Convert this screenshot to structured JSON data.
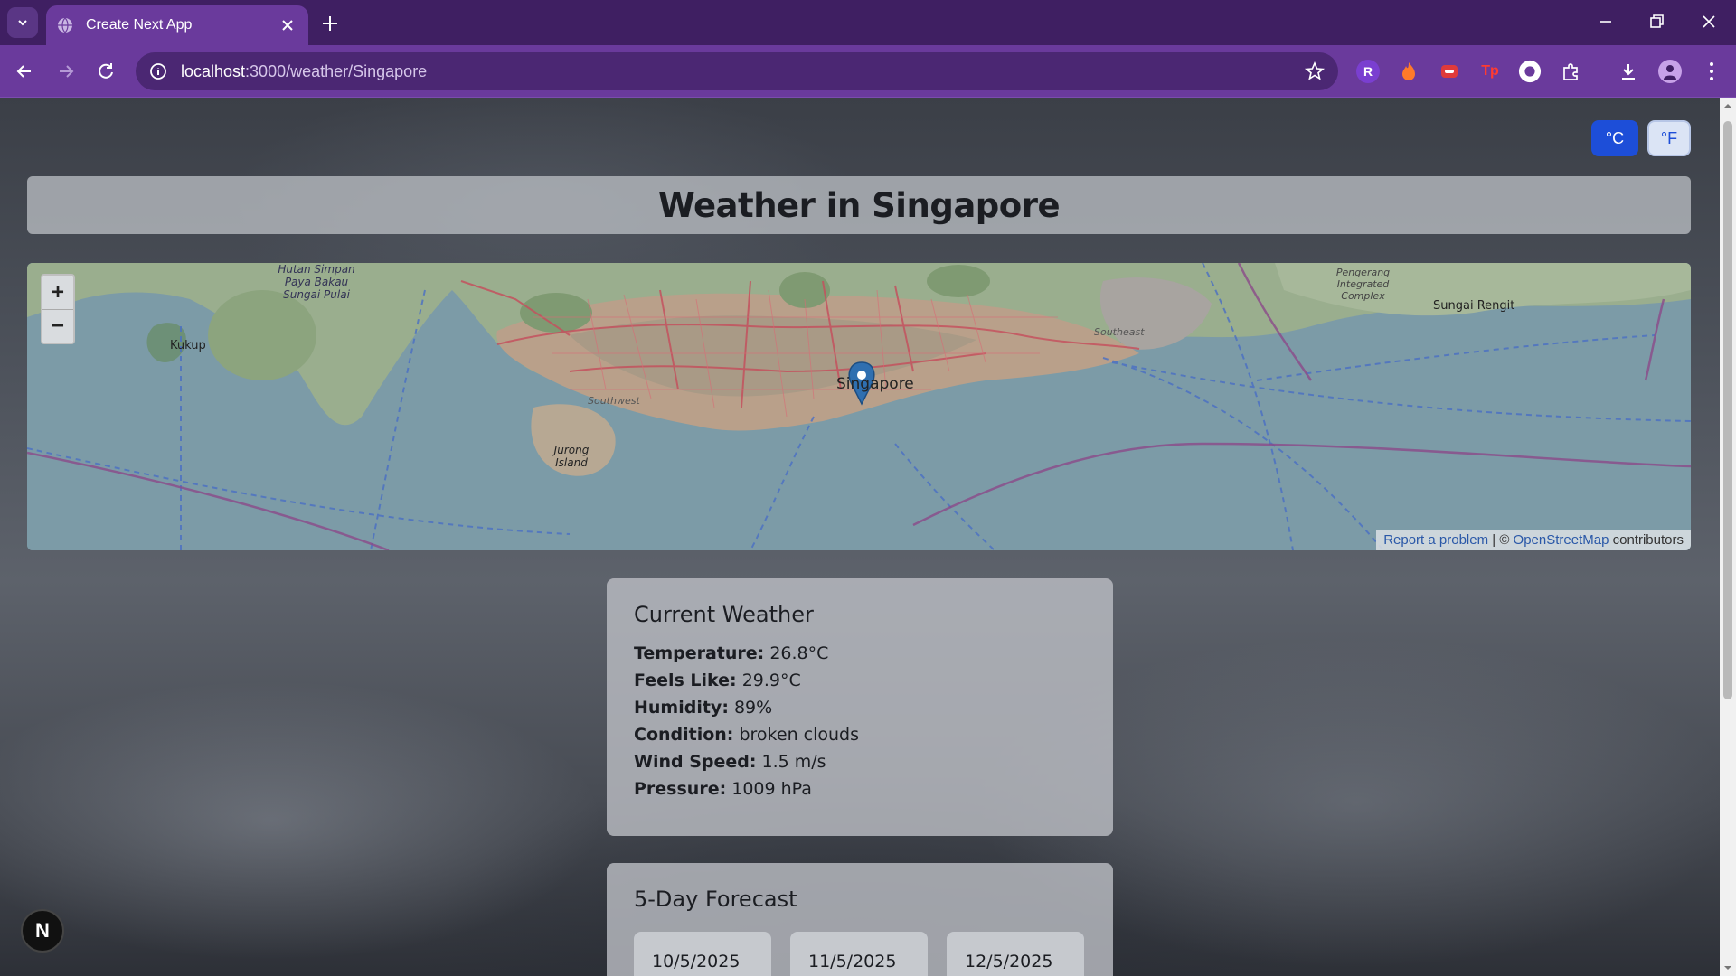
{
  "browser": {
    "tab_title": "Create Next App",
    "url_host": "localhost",
    "url_path": ":3000/weather/Singapore"
  },
  "units": {
    "celsius_label": "°C",
    "fahrenheit_label": "°F",
    "selected": "celsius"
  },
  "page_title": "Weather in Singapore",
  "map": {
    "zoom_in": "+",
    "zoom_out": "−",
    "attribution_report": "Report a problem",
    "attribution_sep": " | © ",
    "attribution_osm": "OpenStreetMap",
    "attribution_suffix": " contributors",
    "labels": {
      "kukup": "Kukup",
      "jurong": "Jurong Island",
      "singapore": "Singapore",
      "southwest": "Southwest",
      "southeast": "Southeast",
      "sungai_rengit": "Sungai Rengit",
      "pengerang": "Pengerang Integrated Complex",
      "hutan": "Hutan Simpan Paya Bakau Sungai Pulai"
    }
  },
  "current": {
    "heading": "Current Weather",
    "rows": [
      {
        "label": "Temperature:",
        "value": "26.8°C"
      },
      {
        "label": "Feels Like:",
        "value": "29.9°C"
      },
      {
        "label": "Humidity:",
        "value": "89%"
      },
      {
        "label": "Condition:",
        "value": "broken clouds"
      },
      {
        "label": "Wind Speed:",
        "value": "1.5 m/s"
      },
      {
        "label": "Pressure:",
        "value": "1009 hPa"
      }
    ]
  },
  "forecast": {
    "heading": "5-Day Forecast",
    "days": [
      "10/5/2025",
      "11/5/2025",
      "12/5/2025"
    ]
  },
  "badge": "N",
  "colors": {
    "accent": "#1d4ed8",
    "chrome": "#6a3a9c",
    "tabstrip": "#3f1f62"
  }
}
